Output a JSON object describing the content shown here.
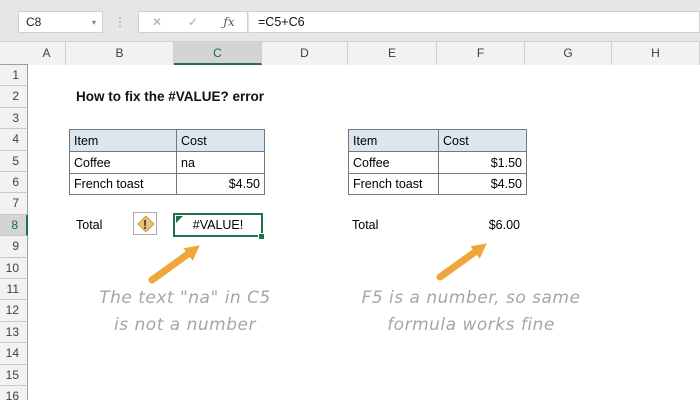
{
  "formula_bar": {
    "name_box": "C8",
    "name_box_dropdown_icon": "▾",
    "dots_icon": "⋮",
    "cancel_icon": "✕",
    "enter_icon": "✓",
    "fx_icon": "ƒx",
    "formula": "=C5+C6"
  },
  "sheet": {
    "column_headers": [
      "A",
      "B",
      "C",
      "D",
      "E",
      "F",
      "G",
      "H"
    ],
    "selected_column": "C",
    "row_headers": [
      "1",
      "2",
      "3",
      "4",
      "5",
      "6",
      "7",
      "8",
      "9",
      "10",
      "11",
      "12",
      "13",
      "14",
      "15",
      "16"
    ],
    "selected_row": "8",
    "title": "How to fix the #VALUE? error",
    "left_table": {
      "headers": [
        "Item",
        "Cost"
      ],
      "rows": [
        [
          "Coffee",
          "na"
        ],
        [
          "French toast",
          "$4.50"
        ]
      ]
    },
    "right_table": {
      "headers": [
        "Item",
        "Cost"
      ],
      "rows": [
        [
          "Coffee",
          "$1.50"
        ],
        [
          "French toast",
          "$4.50"
        ]
      ]
    },
    "left_total": {
      "label": "Total",
      "value": "#VALUE!"
    },
    "right_total": {
      "label": "Total",
      "value": "$6.00"
    },
    "error_button_glyph": "!",
    "annotations": {
      "left_line1": "The text \"na\" in C5",
      "left_line2": "is not a number",
      "right_line1": "F5 is a number, so same",
      "right_line2": "formula works fine"
    }
  },
  "colors": {
    "selection_green": "#217346",
    "arrow_gold": "#EFA73C",
    "table_header_fill": "#DCE6F1",
    "annotation_gray": "#A6A6A6",
    "error_diamond": "#EAC277"
  }
}
